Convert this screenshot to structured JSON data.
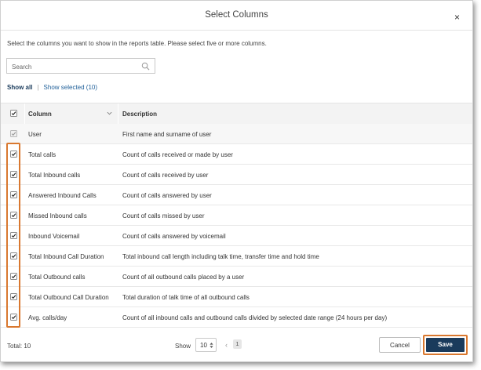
{
  "dialog": {
    "title": "Select Columns",
    "close_glyph": "×",
    "instructions": "Select the columns you want to show in the reports table. Please select five or more columns."
  },
  "search": {
    "placeholder": "Search",
    "value": ""
  },
  "filters": {
    "show_all": "Show all",
    "separator": "|",
    "show_selected": "Show selected (10)"
  },
  "table": {
    "headers": {
      "column": "Column",
      "description": "Description"
    },
    "rows": [
      {
        "column": "User",
        "description": "First name and surname of user",
        "checked": true,
        "disabled": true
      },
      {
        "column": "Total calls",
        "description": "Count of calls received or made by user",
        "checked": true,
        "disabled": false
      },
      {
        "column": "Total Inbound calls",
        "description": "Count of calls received by user",
        "checked": true,
        "disabled": false
      },
      {
        "column": "Answered Inbound Calls",
        "description": "Count of calls answered by user",
        "checked": true,
        "disabled": false
      },
      {
        "column": "Missed Inbound calls",
        "description": "Count of calls missed by user",
        "checked": true,
        "disabled": false
      },
      {
        "column": "Inbound Voicemail",
        "description": "Count of calls answered by voicemail",
        "checked": true,
        "disabled": false
      },
      {
        "column": "Total Inbound Call Duration",
        "description": "Total inbound call length including talk time, transfer time and hold time",
        "checked": true,
        "disabled": false
      },
      {
        "column": "Total Outbound calls",
        "description": "Count of all outbound calls placed by a user",
        "checked": true,
        "disabled": false
      },
      {
        "column": "Total Outbound Call Duration",
        "description": "Total duration of talk time of all outbound calls",
        "checked": true,
        "disabled": false
      },
      {
        "column": "Avg. calls/day",
        "description": "Count of all inbound calls and outbound calls divided by selected date range (24 hours per day)",
        "checked": true,
        "disabled": false
      }
    ]
  },
  "footer": {
    "total": "Total: 10",
    "show_label": "Show",
    "page_size": "10",
    "prev_glyph": "‹",
    "current_page": "1",
    "cancel": "Cancel",
    "save": "Save"
  },
  "colors": {
    "primary": "#1a3b5c",
    "highlight": "#d9782f",
    "link": "#1f5f99"
  }
}
